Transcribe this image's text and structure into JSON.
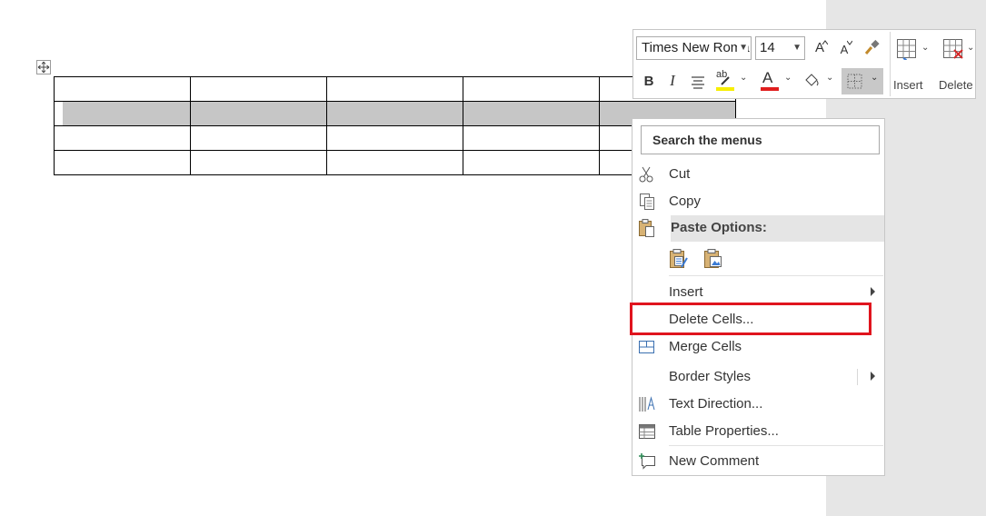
{
  "mini_toolbar": {
    "font_name": "Times New Roma",
    "font_size": "14",
    "grow_font": "A",
    "shrink_font": "A",
    "bold": "B",
    "italic": "I",
    "highlight_glyph": "ab",
    "font_color_glyph": "A",
    "insert_label": "Insert",
    "delete_label": "Delete",
    "highlight_color": "#f7ee00",
    "font_color": "#e01e1e"
  },
  "context_menu": {
    "search_placeholder": "Search the menus",
    "items": [
      {
        "label": "Cut",
        "icon": "scissors-icon"
      },
      {
        "label": "Copy",
        "icon": "copy-icon"
      },
      {
        "label": "Paste Options:",
        "icon": "paste-icon"
      },
      {
        "label": "Insert",
        "submenu": true
      },
      {
        "label": "Delete Cells...",
        "highlighted": true
      },
      {
        "label": "Merge Cells",
        "icon": "merge-cells-icon"
      },
      {
        "label": "Border Styles",
        "submenu": true
      },
      {
        "label": "Text Direction...",
        "icon": "text-direction-icon"
      },
      {
        "label": "Table Properties...",
        "icon": "table-properties-icon"
      },
      {
        "label": "New Comment",
        "icon": "new-comment-icon"
      }
    ]
  },
  "annotation": {
    "color": "#e0141e"
  }
}
